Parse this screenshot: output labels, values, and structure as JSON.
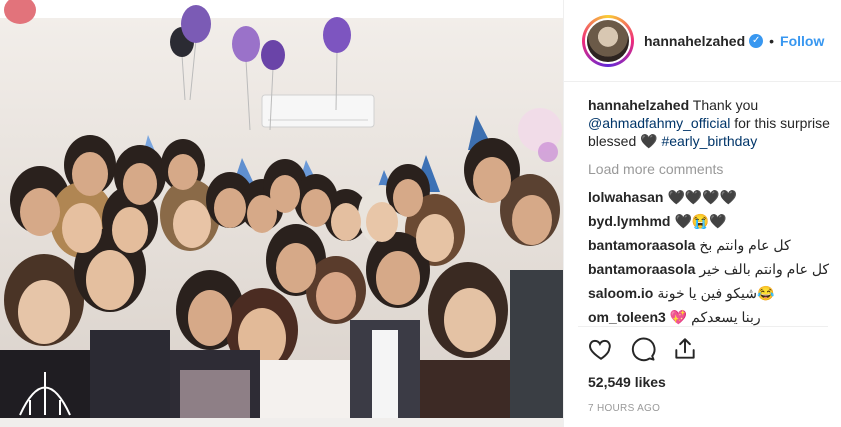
{
  "post": {
    "username": "hannahelzahed",
    "follow_label": "Follow",
    "dot": "•",
    "caption": {
      "username": "hannahelzahed",
      "text_1": " Thank you ",
      "mention": "@ahmadfahmy_official",
      "text_2": " for this surprise blessed ",
      "heart": "🖤",
      "hashtag": "#early_birthday"
    },
    "load_more": "Load more comments",
    "comments": [
      {
        "username": "lolwahasan",
        "text": "🖤🖤🖤🖤"
      },
      {
        "username": "byd.lymhmd",
        "text": "🖤😭🖤"
      },
      {
        "username": "bantamoraasola",
        "text": "كل عام وانتم بخ"
      },
      {
        "username": "bantamoraasola",
        "text": "كل عام وانتم بالف خير"
      },
      {
        "username": "saloom.io",
        "text": "😂شيكو فين يا خونة"
      },
      {
        "username": "om_toleen3",
        "text": "ربنا يسعدكم 💖"
      }
    ],
    "likes": "52,549 likes",
    "timestamp": "7 HOURS AGO"
  },
  "colors": {
    "accent": "#3897f0",
    "link": "#003569",
    "muted": "#999999"
  },
  "icons": [
    "verified-badge-icon",
    "heart-icon",
    "comment-icon",
    "share-icon"
  ]
}
